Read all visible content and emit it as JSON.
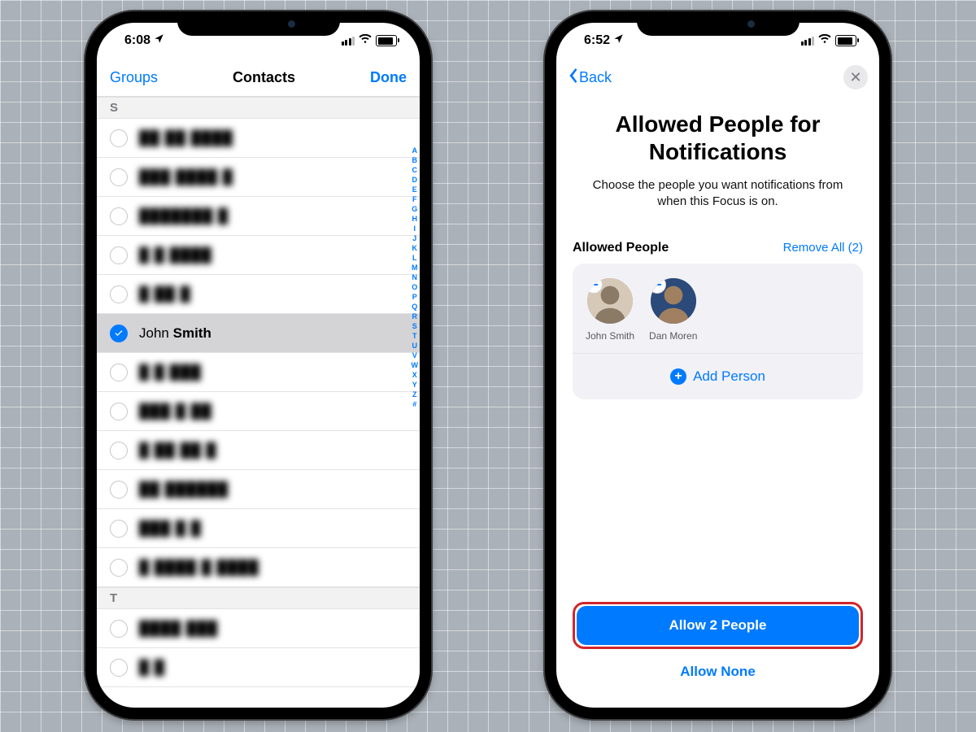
{
  "phone1": {
    "status": {
      "time": "6:08"
    },
    "nav": {
      "left": "Groups",
      "title": "Contacts",
      "right": "Done"
    },
    "section": "S",
    "selected_first": "John",
    "selected_last": "Smith",
    "blur_rows": [
      "██ ██ ████",
      "███ ████ █",
      "███████ █",
      "█ █  ████",
      "█   ██ █",
      "█ █  ███",
      "███ █  ██",
      "█ ██ ██ █",
      "██ ██████",
      "███ █ █",
      "█ ████ █  ████"
    ],
    "section2": "T",
    "t_rows": [
      "████  ███",
      "█ █"
    ],
    "index": [
      "A",
      "B",
      "C",
      "D",
      "E",
      "F",
      "G",
      "H",
      "I",
      "J",
      "K",
      "L",
      "M",
      "N",
      "O",
      "P",
      "Q",
      "R",
      "S",
      "T",
      "U",
      "V",
      "W",
      "X",
      "Y",
      "Z",
      "#"
    ]
  },
  "phone2": {
    "status": {
      "time": "6:52"
    },
    "back": "Back",
    "title1": "Allowed People for",
    "title2": "Notifications",
    "sub": "Choose the people you want notifications from when this Focus is on.",
    "ap_label": "Allowed People",
    "remove_all": "Remove All (2)",
    "people": [
      {
        "name": "John Smith"
      },
      {
        "name": "Dan Moren"
      }
    ],
    "add_person": "Add Person",
    "allow_btn": "Allow 2 People",
    "allow_none": "Allow None"
  }
}
